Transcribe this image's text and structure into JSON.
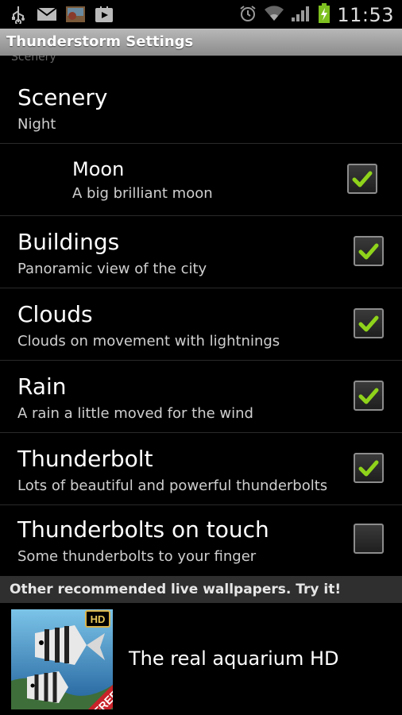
{
  "status_bar": {
    "time": "11:53",
    "left_icons": [
      "usb-icon",
      "mail-icon",
      "photo-icon",
      "play-store-icon"
    ],
    "right_icons": [
      "alarm-icon",
      "wifi-icon",
      "signal-icon",
      "battery-charging-icon"
    ]
  },
  "title_bar": {
    "title": "Thunderstorm Settings"
  },
  "partial_header": "Scenery",
  "settings": [
    {
      "title": "Scenery",
      "subtitle": "Night",
      "has_checkbox": false
    },
    {
      "title": "Moon",
      "subtitle": "A big brilliant moon",
      "has_checkbox": true,
      "checked": true,
      "indented": true
    },
    {
      "title": "Buildings",
      "subtitle": "Panoramic view of the city",
      "has_checkbox": true,
      "checked": true
    },
    {
      "title": "Clouds",
      "subtitle": "Clouds on movement with lightnings",
      "has_checkbox": true,
      "checked": true
    },
    {
      "title": "Rain",
      "subtitle": "A rain a little moved for the wind",
      "has_checkbox": true,
      "checked": true
    },
    {
      "title": "Thunderbolt",
      "subtitle": "Lots of beautiful and powerful thunderbolts",
      "has_checkbox": true,
      "checked": true
    },
    {
      "title": "Thunderbolts on touch",
      "subtitle": "Some thunderbolts to your finger",
      "has_checkbox": true,
      "checked": false
    }
  ],
  "section_header": "Other recommended live wallpapers. Try it!",
  "promo": {
    "title": "The real aquarium HD",
    "badge_hd": "HD",
    "badge_free": "FREE"
  },
  "colors": {
    "checkmark": "#8fd31b",
    "titlebar": "#a8a8a8",
    "background": "#000000"
  }
}
